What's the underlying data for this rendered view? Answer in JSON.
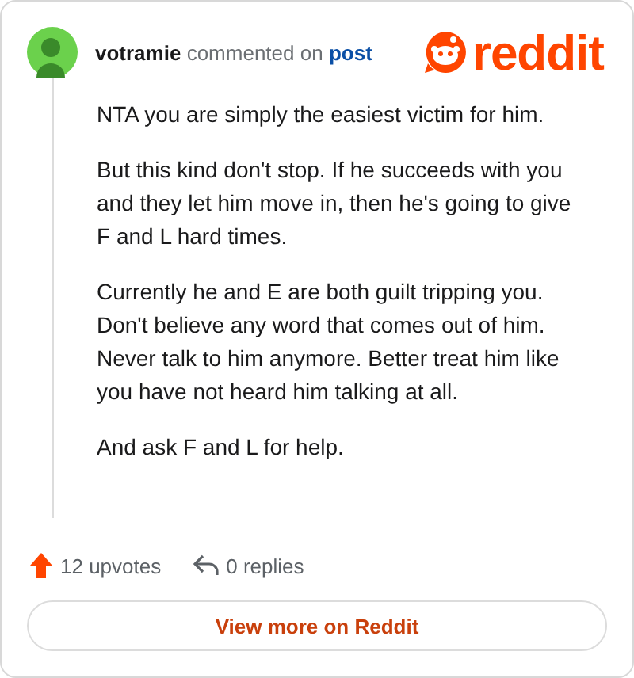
{
  "comment": {
    "author": "votramie",
    "action": "commented on",
    "target": "post",
    "logo": "reddit",
    "paragraphs": [
      "NTA you are simply the easiest victim for him.",
      "But this kind don't stop. If he succeeds with you and they let him move in, then he's going to give F and L hard times.",
      "Currently he and E are both guilt tripping you. Don't believe any word that comes out of him. Never talk to him anymore. Better treat him like you have not heard him talking at all.",
      "And ask F and L for help."
    ],
    "upvotes": "12 upvotes",
    "replies": "0 replies"
  },
  "button": "View more on Reddit"
}
